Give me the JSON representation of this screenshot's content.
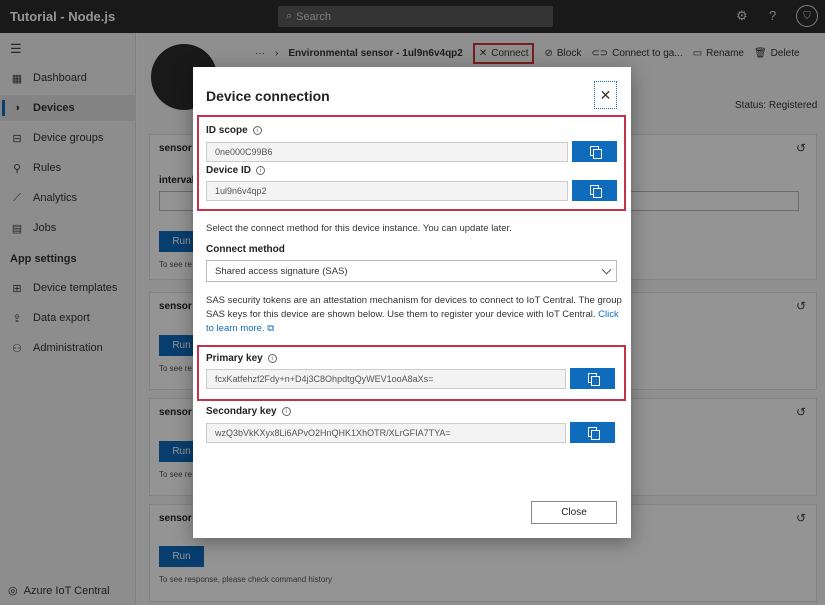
{
  "app": {
    "title": "Tutorial - Node.js"
  },
  "search": {
    "placeholder": "Search"
  },
  "sidebar": {
    "items": [
      {
        "label": "Dashboard"
      },
      {
        "label": "Devices"
      },
      {
        "label": "Device groups"
      },
      {
        "label": "Rules"
      },
      {
        "label": "Analytics"
      },
      {
        "label": "Jobs"
      }
    ],
    "section": "App settings",
    "settings_items": [
      {
        "label": "Device templates"
      },
      {
        "label": "Data export"
      },
      {
        "label": "Administration"
      }
    ],
    "footer": "Azure IoT Central"
  },
  "breadcrumb": {
    "ellipsis": "···",
    "device": "Environmental sensor - 1ul9n6v4qp2"
  },
  "commands": {
    "connect": "Connect",
    "block": "Block",
    "connect_gateway": "Connect to ga...",
    "rename": "Rename",
    "delete": "Delete"
  },
  "status": "Status: Registered",
  "cards": [
    {
      "title": "sensor",
      "label": "interval",
      "run": "Run",
      "note": "To see re"
    },
    {
      "title": "sensor",
      "run": "Run",
      "note": "To see re"
    },
    {
      "title": "sensor",
      "run": "Run",
      "note": "To see re"
    },
    {
      "title": "sensor",
      "run": "Run",
      "note": "To see response, please check command history"
    }
  ],
  "dialog": {
    "title": "Device connection",
    "id_scope": {
      "label": "ID scope",
      "value": "0ne000C99B6"
    },
    "device_id": {
      "label": "Device ID",
      "value": "1ul9n6v4qp2"
    },
    "select_text": "Select the connect method for this device instance. You can update later.",
    "connect_method": {
      "label": "Connect method",
      "value": "Shared access signature (SAS)"
    },
    "sas_text": "SAS security tokens are an attestation mechanism for devices to connect to IoT Central. The group SAS keys for this device are shown below. Use them to register your device with IoT Central.",
    "learn_more": "Click to learn more.",
    "primary_key": {
      "label": "Primary key",
      "value": "fcxKatfehzf2Fdy+n+D4j3C8OhpdtgQyWEV1ooA8aXs="
    },
    "secondary_key": {
      "label": "Secondary key",
      "value": "wzQ3bVkKXyx8Li6APvO2HnQHK1XhOTR/XLrGFIA7TYA="
    },
    "close": "Close"
  },
  "colors": {
    "accent": "#0f6cbd",
    "highlight": "#c4314b",
    "topbar": "#2b2b2b"
  }
}
